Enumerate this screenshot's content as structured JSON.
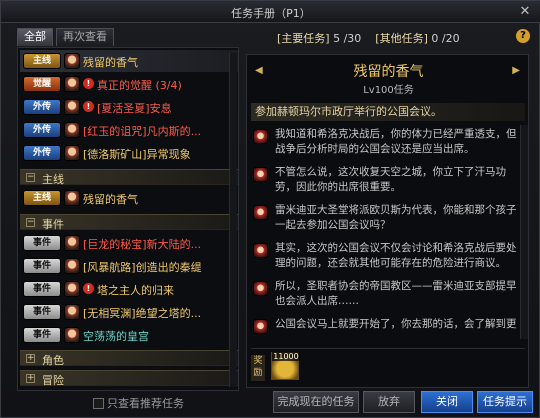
{
  "window": {
    "title": "任务手册（P1）",
    "close_glyph": "✕"
  },
  "tabs": [
    {
      "label": "全部",
      "active": true
    },
    {
      "label": "再次查看",
      "active": false
    }
  ],
  "badges": {
    "main": "主线",
    "awake": "觉醒",
    "side": "外传",
    "event": "事件"
  },
  "quest_list": {
    "top": [
      {
        "type": "main",
        "name": "残留的香气",
        "color": "gold",
        "warn": false,
        "selected": true
      },
      {
        "type": "awake",
        "name": "真正的觉醒 (3/4)",
        "color": "red",
        "warn": true
      },
      {
        "type": "side",
        "name": "[夏活圣夏]安息",
        "color": "red",
        "warn": true
      },
      {
        "type": "side",
        "name": "[红玉的诅咒]凡内斯的...",
        "color": "red",
        "warn": false
      },
      {
        "type": "side",
        "name": "[德洛斯矿山]异常现象",
        "color": "gold",
        "warn": false
      }
    ],
    "categories": {
      "main": {
        "label": "主线",
        "toggle": "−"
      },
      "event": {
        "label": "事件",
        "toggle": "−"
      },
      "role": {
        "label": "角色",
        "toggle": "+"
      },
      "adventure": {
        "label": "冒险",
        "toggle": "+"
      }
    },
    "main_items": [
      {
        "type": "main",
        "name": "残留的香气",
        "color": "gold"
      }
    ],
    "event_items": [
      {
        "type": "event",
        "name": "[巨龙的秘宝]新大陆的...",
        "color": "red",
        "warn": false
      },
      {
        "type": "event",
        "name": "[风暴航路]创造出的秦缇",
        "color": "gold",
        "warn": false
      },
      {
        "type": "event",
        "name": "塔之主人的归来",
        "color": "gold",
        "warn": true
      },
      {
        "type": "event",
        "name": "[无相冥渊]绝望之塔的...",
        "color": "gold",
        "warn": false
      },
      {
        "type": "event",
        "name": "空荡荡的皇宫",
        "color": "teal",
        "warn": false
      }
    ]
  },
  "filter": {
    "label": "只查看推荐任务",
    "checked": false
  },
  "stats": {
    "main_label": "[主要任务]",
    "main_value": "5 /30",
    "other_label": "[其他任务]",
    "other_value": "0 /20"
  },
  "help_glyph": "?",
  "detail": {
    "title": "残留的香气",
    "level": "Lv100任务",
    "objective": "参加赫顿玛尔市政厅举行的公国会议。",
    "dialogue": [
      "我知道和希洛克决战后，你的体力已经严重透支，但战争后分析时局的公国会议还是应当出席。",
      "不管怎么说，这次收复天空之城，你立下了汗马功劳，因此你的出席很重要。",
      "雷米迪亚大圣堂将派欧贝斯为代表，你能和那个孩子一起去参加公国会议吗？",
      "其实，这次的公国会议不仅会讨论和希洛克战后要处理的问题，还会就其他可能存在的危险进行商议。",
      "所以，圣职者协会的帝国教区——雷米迪亚支部提早也会派人出席……",
      "公国会议马上就要开始了，你去那的话，会了解到更"
    ],
    "reward_label": "奖励",
    "reward_qty": "11000"
  },
  "buttons": {
    "complete": "完成现在的任务",
    "abandon": "放弃",
    "close": "关闭",
    "hint": "任务提示"
  }
}
